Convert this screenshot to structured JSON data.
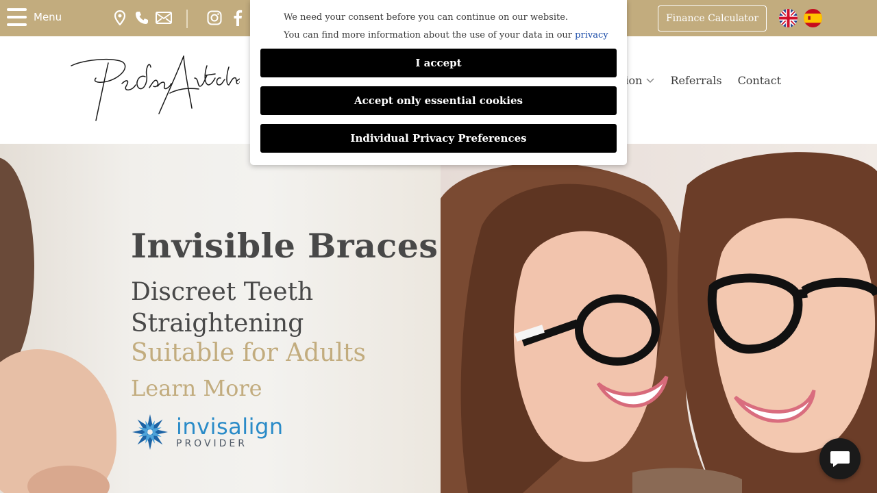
{
  "topbar": {
    "menu_label": "Menu",
    "icons": [
      "map-pin-icon",
      "phone-icon",
      "mail-icon",
      "instagram-icon",
      "facebook-icon"
    ],
    "finance_label": "Finance Calculator",
    "languages": [
      "English",
      "Español"
    ],
    "colors": {
      "bar": "#c2ac7e"
    }
  },
  "header": {
    "logo_text": "Pedro Arteche",
    "nav": [
      {
        "label": "tion",
        "has_dropdown": true
      },
      {
        "label": "Referrals",
        "has_dropdown": false
      },
      {
        "label": "Contact",
        "has_dropdown": false
      }
    ]
  },
  "hero": {
    "title": "Invisible Braces",
    "subtitle": "Discreet Teeth Straightening",
    "accent": "Suitable for Adults",
    "cta": "Learn More",
    "badge": {
      "brand": "invisalign",
      "tagline": "PROVIDER"
    },
    "colors": {
      "accent": "#c2ac7e",
      "text": "#484848",
      "invisalign_blue": "#2a8bc8"
    }
  },
  "cookie": {
    "line1": "We need your consent before you can continue on our website.",
    "line2_prefix": "You can find more information about the use of your data in our ",
    "link_text": "privacy policy",
    "line2_suffix": ".",
    "accept": "I accept",
    "essential": "Accept only essential cookies",
    "preferences": "Individual Privacy Preferences"
  },
  "chat": {
    "icon": "chat-bubble-icon"
  }
}
